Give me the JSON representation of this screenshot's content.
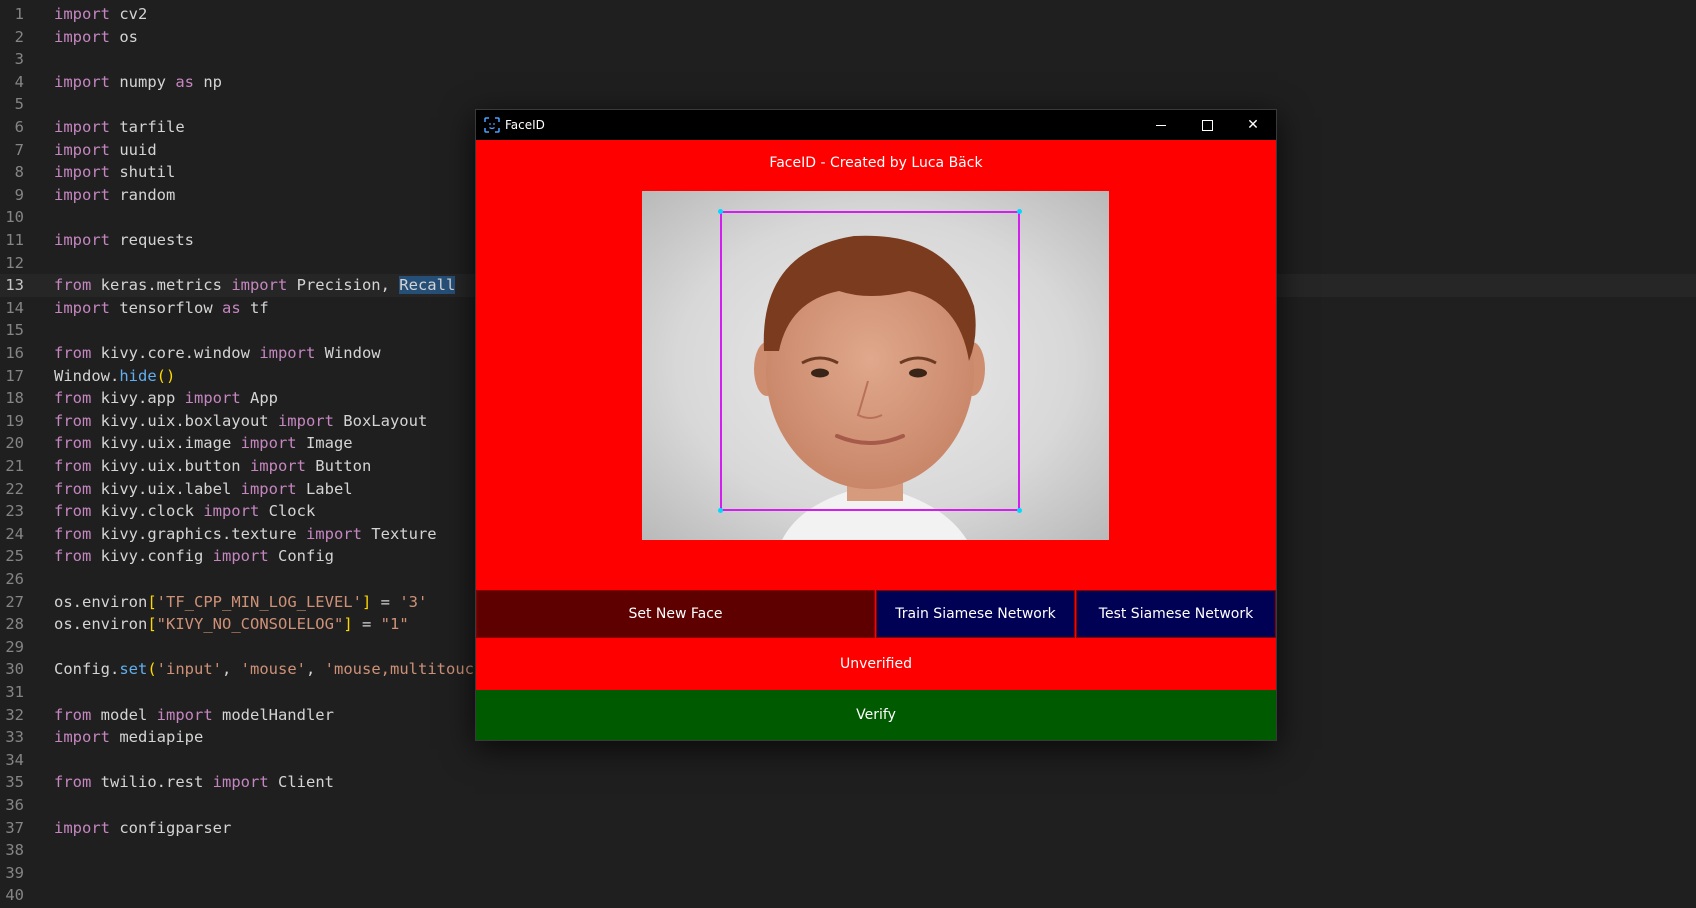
{
  "editor": {
    "lines": [
      {
        "n": "1",
        "segs": [
          {
            "t": "import",
            "c": "kw"
          },
          {
            "t": " cv2"
          }
        ]
      },
      {
        "n": "2",
        "segs": [
          {
            "t": "import",
            "c": "kw"
          },
          {
            "t": " os"
          }
        ]
      },
      {
        "n": "3",
        "segs": []
      },
      {
        "n": "4",
        "segs": [
          {
            "t": "import",
            "c": "kw"
          },
          {
            "t": " numpy "
          },
          {
            "t": "as",
            "c": "kw"
          },
          {
            "t": " np"
          }
        ]
      },
      {
        "n": "5",
        "segs": []
      },
      {
        "n": "6",
        "segs": [
          {
            "t": "import",
            "c": "kw"
          },
          {
            "t": " tarfile"
          }
        ]
      },
      {
        "n": "7",
        "segs": [
          {
            "t": "import",
            "c": "kw"
          },
          {
            "t": " uuid"
          }
        ]
      },
      {
        "n": "8",
        "segs": [
          {
            "t": "import",
            "c": "kw"
          },
          {
            "t": " shutil"
          }
        ]
      },
      {
        "n": "9",
        "segs": [
          {
            "t": "import",
            "c": "kw"
          },
          {
            "t": " random"
          }
        ]
      },
      {
        "n": "10",
        "segs": []
      },
      {
        "n": "11",
        "segs": [
          {
            "t": "import",
            "c": "kw"
          },
          {
            "t": " requests"
          }
        ]
      },
      {
        "n": "12",
        "segs": []
      },
      {
        "n": "13",
        "current": true,
        "segs": [
          {
            "t": "from",
            "c": "kw"
          },
          {
            "t": " keras.metrics "
          },
          {
            "t": "import",
            "c": "kw"
          },
          {
            "t": " Precision, "
          },
          {
            "t": "Recall",
            "c": "sel"
          }
        ]
      },
      {
        "n": "14",
        "segs": [
          {
            "t": "import",
            "c": "kw"
          },
          {
            "t": " tensorflow "
          },
          {
            "t": "as",
            "c": "kw"
          },
          {
            "t": " tf"
          }
        ]
      },
      {
        "n": "15",
        "segs": []
      },
      {
        "n": "16",
        "segs": [
          {
            "t": "from",
            "c": "kw"
          },
          {
            "t": " kivy.core.window "
          },
          {
            "t": "import",
            "c": "kw"
          },
          {
            "t": " Window"
          }
        ]
      },
      {
        "n": "17",
        "segs": [
          {
            "t": "Window."
          },
          {
            "t": "hide",
            "c": "fn"
          },
          {
            "t": "()",
            "c": "pb"
          }
        ]
      },
      {
        "n": "18",
        "segs": [
          {
            "t": "from",
            "c": "kw"
          },
          {
            "t": " kivy.app "
          },
          {
            "t": "import",
            "c": "kw"
          },
          {
            "t": " App"
          }
        ]
      },
      {
        "n": "19",
        "segs": [
          {
            "t": "from",
            "c": "kw"
          },
          {
            "t": " kivy.uix.boxlayout "
          },
          {
            "t": "import",
            "c": "kw"
          },
          {
            "t": " BoxLayout"
          }
        ]
      },
      {
        "n": "20",
        "segs": [
          {
            "t": "from",
            "c": "kw"
          },
          {
            "t": " kivy.uix.image "
          },
          {
            "t": "import",
            "c": "kw"
          },
          {
            "t": " Image"
          }
        ]
      },
      {
        "n": "21",
        "segs": [
          {
            "t": "from",
            "c": "kw"
          },
          {
            "t": " kivy.uix.button "
          },
          {
            "t": "import",
            "c": "kw"
          },
          {
            "t": " Button"
          }
        ]
      },
      {
        "n": "22",
        "segs": [
          {
            "t": "from",
            "c": "kw"
          },
          {
            "t": " kivy.uix.label "
          },
          {
            "t": "import",
            "c": "kw"
          },
          {
            "t": " Label"
          }
        ]
      },
      {
        "n": "23",
        "segs": [
          {
            "t": "from",
            "c": "kw"
          },
          {
            "t": " kivy.clock "
          },
          {
            "t": "import",
            "c": "kw"
          },
          {
            "t": " Clock"
          }
        ]
      },
      {
        "n": "24",
        "segs": [
          {
            "t": "from",
            "c": "kw"
          },
          {
            "t": " kivy.graphics.texture "
          },
          {
            "t": "import",
            "c": "kw"
          },
          {
            "t": " Texture"
          }
        ]
      },
      {
        "n": "25",
        "segs": [
          {
            "t": "from",
            "c": "kw"
          },
          {
            "t": " kivy.config "
          },
          {
            "t": "import",
            "c": "kw"
          },
          {
            "t": " Config"
          }
        ]
      },
      {
        "n": "26",
        "segs": []
      },
      {
        "n": "27",
        "segs": [
          {
            "t": "os.environ"
          },
          {
            "t": "[",
            "c": "pb"
          },
          {
            "t": "'TF_CPP_MIN_LOG_LEVEL'",
            "c": "str"
          },
          {
            "t": "]",
            "c": "pb"
          },
          {
            "t": " = "
          },
          {
            "t": "'3'",
            "c": "str"
          }
        ]
      },
      {
        "n": "28",
        "segs": [
          {
            "t": "os.environ"
          },
          {
            "t": "[",
            "c": "pb"
          },
          {
            "t": "\"KIVY_NO_CONSOLELOG\"",
            "c": "str"
          },
          {
            "t": "]",
            "c": "pb"
          },
          {
            "t": " = "
          },
          {
            "t": "\"1\"",
            "c": "str"
          }
        ]
      },
      {
        "n": "29",
        "segs": []
      },
      {
        "n": "30",
        "segs": [
          {
            "t": "Config."
          },
          {
            "t": "set",
            "c": "fn"
          },
          {
            "t": "(",
            "c": "pb"
          },
          {
            "t": "'input'",
            "c": "str"
          },
          {
            "t": ", "
          },
          {
            "t": "'mouse'",
            "c": "str"
          },
          {
            "t": ", "
          },
          {
            "t": "'mouse,multitouch",
            "c": "str"
          }
        ]
      },
      {
        "n": "31",
        "segs": []
      },
      {
        "n": "32",
        "segs": [
          {
            "t": "from",
            "c": "kw"
          },
          {
            "t": " model "
          },
          {
            "t": "import",
            "c": "kw"
          },
          {
            "t": " modelHandler"
          }
        ]
      },
      {
        "n": "33",
        "segs": [
          {
            "t": "import",
            "c": "kw"
          },
          {
            "t": " mediapipe"
          }
        ]
      },
      {
        "n": "34",
        "segs": []
      },
      {
        "n": "35",
        "segs": [
          {
            "t": "from",
            "c": "kw"
          },
          {
            "t": " twilio.rest "
          },
          {
            "t": "import",
            "c": "kw"
          },
          {
            "t": " Client"
          }
        ]
      },
      {
        "n": "36",
        "segs": []
      },
      {
        "n": "37",
        "segs": [
          {
            "t": "import",
            "c": "kw"
          },
          {
            "t": " configparser"
          }
        ]
      },
      {
        "n": "38",
        "segs": []
      },
      {
        "n": "39",
        "segs": []
      },
      {
        "n": "40",
        "segs": []
      }
    ]
  },
  "window": {
    "title": "FaceID",
    "header": "FaceID - Created by Luca Bäck",
    "buttons": {
      "set_new_face": "Set New Face",
      "train": "Train Siamese Network",
      "test": "Test Siamese Network",
      "verify": "Verify"
    },
    "status": "Unverified",
    "controls": {
      "minimize": "minimize-icon",
      "maximize": "maximize-icon",
      "close": "close-icon"
    }
  },
  "colors": {
    "editor_bg": "#1f1f1f",
    "window_bg": "#ff0000",
    "set_face_bg": "#5e0000",
    "network_btn_bg": "#000055",
    "verify_bg": "#005a00",
    "face_box": "#d21ff0"
  }
}
